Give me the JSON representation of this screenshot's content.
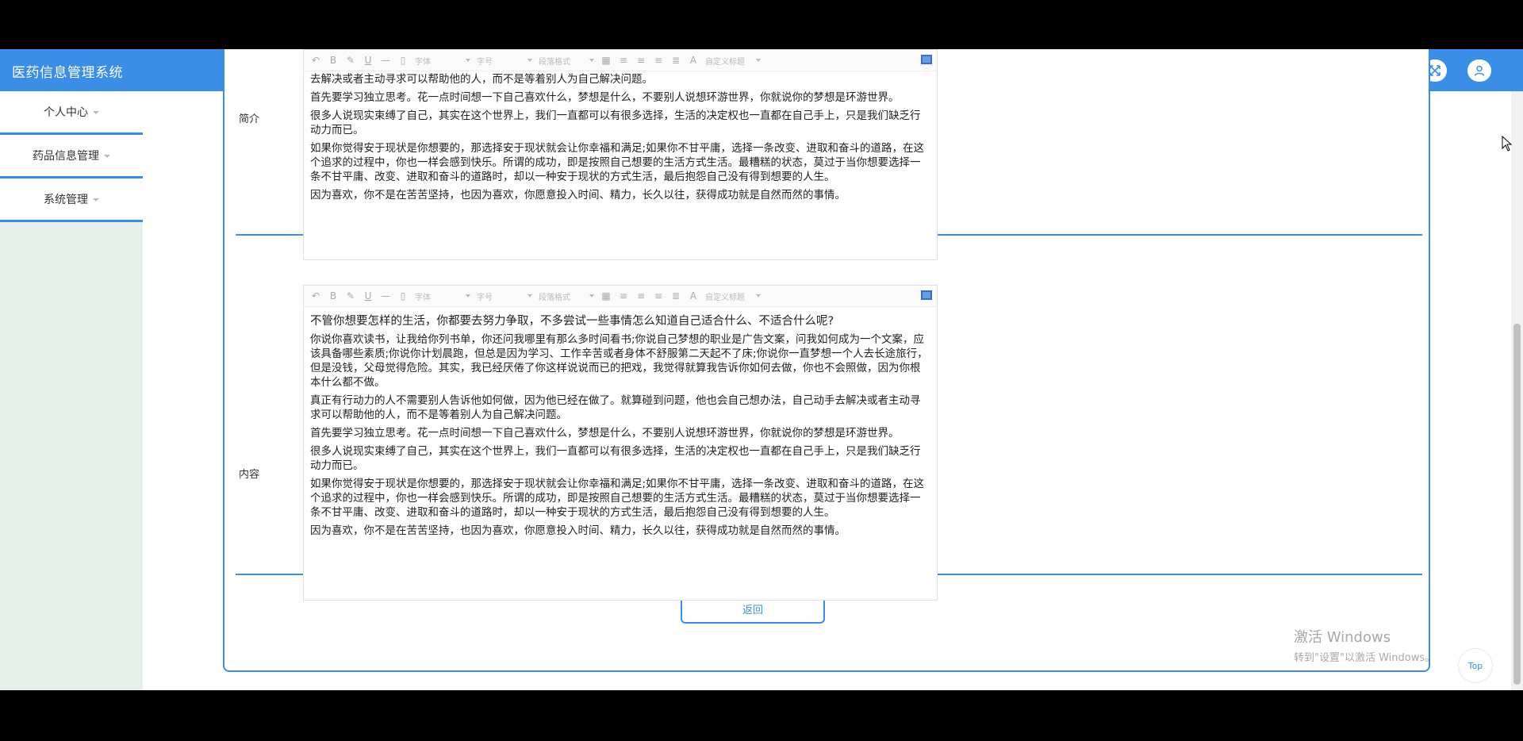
{
  "app": {
    "title": "医药信息管理系统"
  },
  "header": {
    "fullscreen_icon": "fullscreen-icon",
    "user_icon": "user-icon"
  },
  "sidebar": {
    "items": [
      {
        "label": "个人中心"
      },
      {
        "label": "药品信息管理"
      },
      {
        "label": "系统管理"
      }
    ]
  },
  "form": {
    "intro_label": "简介",
    "content_label": "内容",
    "back_label": "返回"
  },
  "toolbar": {
    "font_label": "字体",
    "size_label": "字号",
    "paragraph_label": "段落格式",
    "custom_title_label": "自定义标题"
  },
  "editor1": {
    "paragraphs": [
      "去解决或者主动寻求可以帮助他的人，而不是等着别人为自己解决问题。",
      "首先要学习独立思考。花一点时间想一下自己喜欢什么，梦想是什么，不要别人说想环游世界，你就说你的梦想是环游世界。",
      "很多人说现实束缚了自己，其实在这个世界上，我们一直都可以有很多选择，生活的决定权也一直都在自己手上，只是我们缺乏行动力而已。",
      "如果你觉得安于现状是你想要的，那选择安于现状就会让你幸福和满足;如果你不甘平庸，选择一条改变、进取和奋斗的道路，在这个追求的过程中，你也一样会感到快乐。所谓的成功，即是按照自己想要的生活方式生活。最糟糕的状态，莫过于当你想要选择一条不甘平庸、改变、进取和奋斗的道路时，却以一种安于现状的方式生活，最后抱怨自己没有得到想要的人生。",
      "因为喜欢，你不是在苦苦坚持，也因为喜欢，你愿意投入时间、精力，长久以往，获得成功就是自然而然的事情。"
    ]
  },
  "editor2": {
    "paragraphs": [
      "不管你想要怎样的生活，你都要去努力争取，不多尝试一些事情怎么知道自己适合什么、不适合什么呢?",
      "你说你喜欢读书，让我给你列书单，你还问我哪里有那么多时间看书;你说自己梦想的职业是广告文案，问我如何成为一个文案，应该具备哪些素质;你说你计划晨跑，但总是因为学习、工作辛苦或者身体不舒服第二天起不了床;你说你一直梦想一个人去长途旅行，但是没钱，父母觉得危险。其实，我已经厌倦了你这样说说而已的把戏，我觉得就算我告诉你如何去做，你也不会照做，因为你根本什么都不做。",
      "真正有行动力的人不需要别人告诉他如何做，因为他已经在做了。就算碰到问题，他也会自己想办法，自己动手去解决或者主动寻求可以帮助他的人，而不是等着别人为自己解决问题。",
      "首先要学习独立思考。花一点时间想一下自己喜欢什么，梦想是什么，不要别人说想环游世界，你就说你的梦想是环游世界。",
      "很多人说现实束缚了自己，其实在这个世界上，我们一直都可以有很多选择，生活的决定权也一直都在自己手上，只是我们缺乏行动力而已。",
      "如果你觉得安于现状是你想要的，那选择安于现状就会让你幸福和满足;如果你不甘平庸，选择一条改变、进取和奋斗的道路，在这个追求的过程中，你也一样会感到快乐。所谓的成功，即是按照自己想要的生活方式生活。最糟糕的状态，莫过于当你想要选择一条不甘平庸、改变、进取和奋斗的道路时，却以一种安于现状的方式生活，最后抱怨自己没有得到想要的人生。",
      "因为喜欢，你不是在苦苦坚持，也因为喜欢，你愿意投入时间、精力，长久以往，获得成功就是自然而然的事情。"
    ]
  },
  "watermark": {
    "title": "激活 Windows",
    "subtitle": "转到\"设置\"以激活 Windows。"
  },
  "top_button": {
    "label": "Top"
  },
  "colors": {
    "accent": "#3a8ee6",
    "sidebar_bg": "#e7f1eb"
  }
}
